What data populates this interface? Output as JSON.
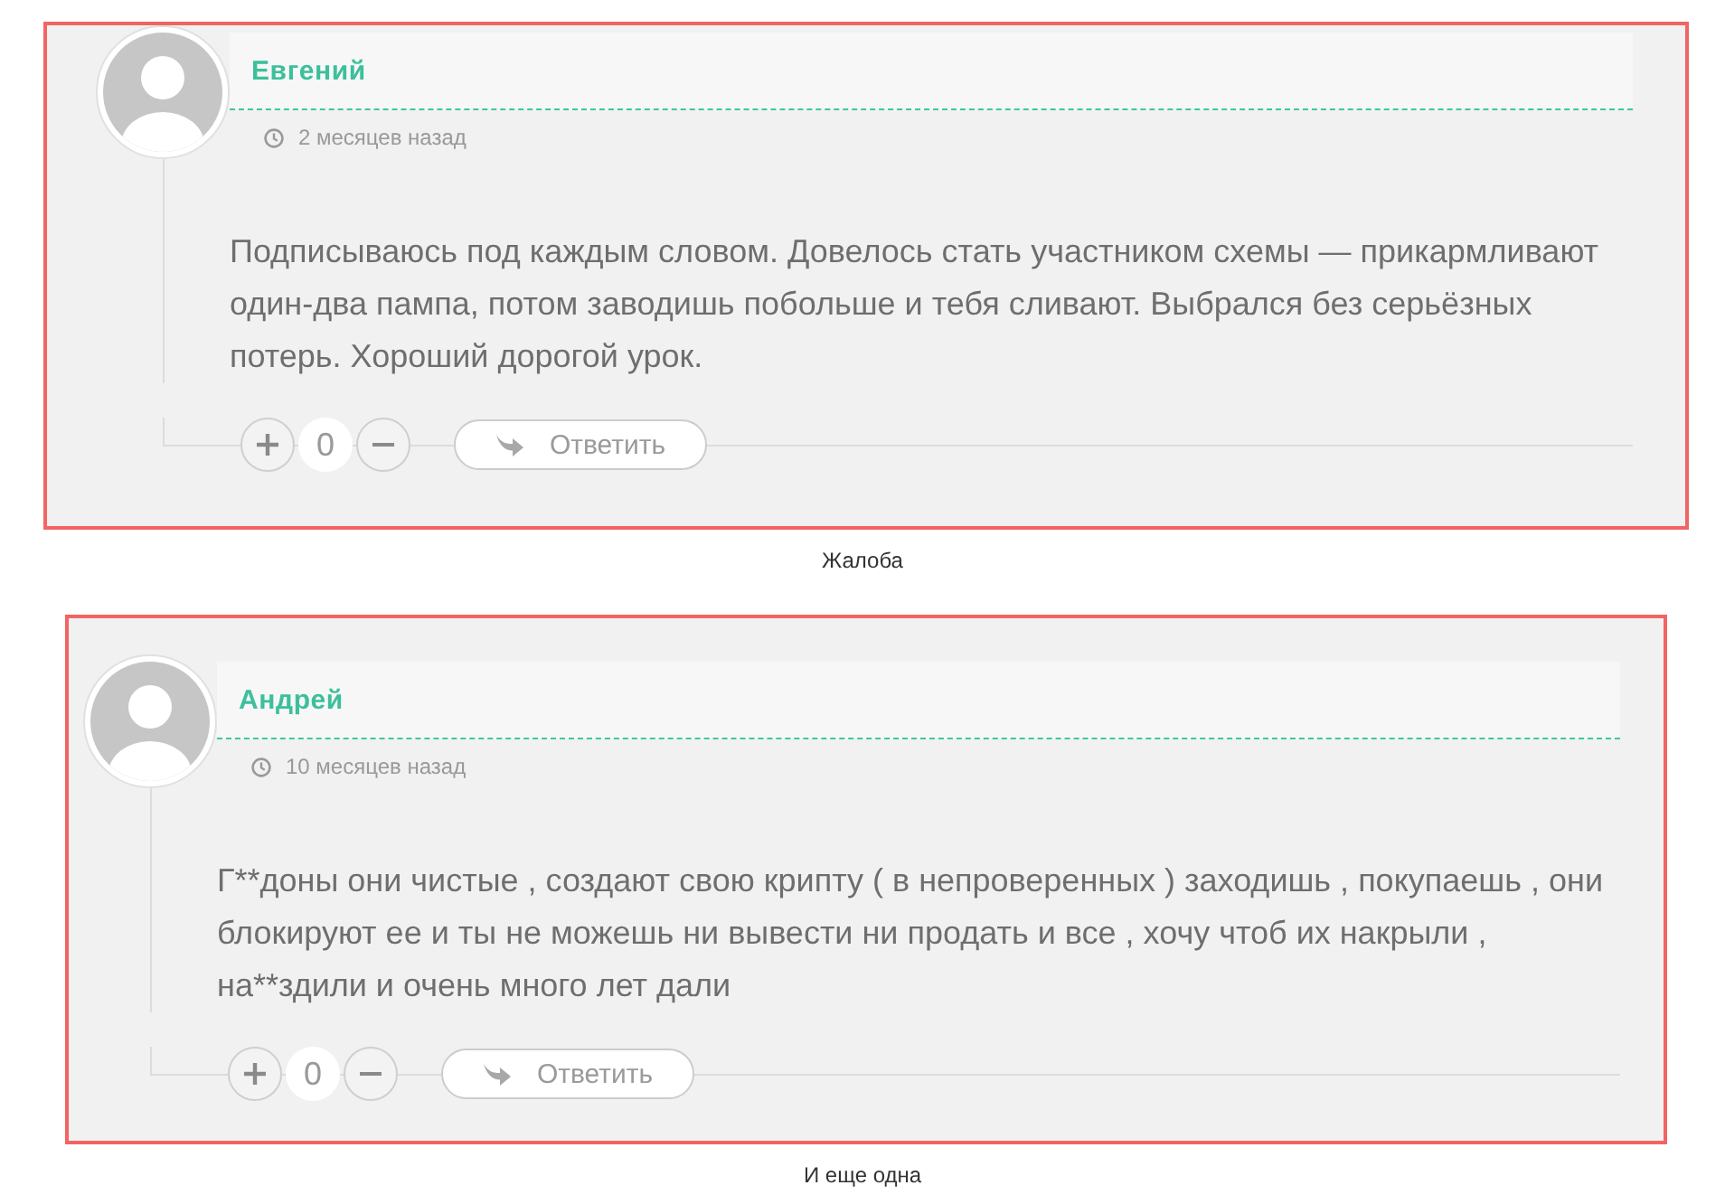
{
  "screenshots": [
    {
      "comment": {
        "author": "Евгений",
        "time": "2 месяцев назад",
        "text": "Подписываюсь под каждым словом. Довелось стать участником схемы — прикармливают один-два пампа, потом заводишь побольше и тебя сливают. Выбрался без серьёзных потерь. Хороший дорогой урок.",
        "votes": "0",
        "reply_label": "Ответить"
      },
      "caption": "Жалоба"
    },
    {
      "comment": {
        "author": "Андрей",
        "time": "10 месяцев назад",
        "text": "Г**доны они чистые , создают свою крипту ( в непроверенных ) заходишь , покупаешь , они блокируют ее и ты не можешь ни вывести ни продать и все , хочу чтоб их накрыли , на**здили и очень много лет дали",
        "votes": "0",
        "reply_label": "Ответить"
      },
      "caption": "И еще одна"
    }
  ]
}
